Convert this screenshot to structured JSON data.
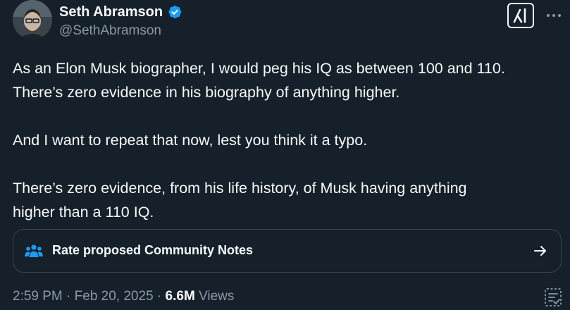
{
  "author": {
    "display_name": "Seth Abramson",
    "handle": "@SethAbramson",
    "verified": true,
    "avatar_icon": "avatar-photo"
  },
  "header_actions": {
    "grok_icon": "grok-icon",
    "more_icon": "more-dots-icon"
  },
  "tweet": {
    "paragraphs": [
      [
        "As an Elon Musk biographer, I would peg his IQ as between 100 and 110.",
        "There’s zero evidence in his biography of anything higher."
      ],
      [
        "And I want to repeat that now, lest you think it a typo."
      ],
      [
        "There’s zero evidence, from his life history, of Musk having anything",
        "higher than a 110 IQ."
      ]
    ]
  },
  "community_notes": {
    "label": "Rate proposed Community Notes",
    "icon": "people-icon",
    "arrow_icon": "arrow-right-icon"
  },
  "meta": {
    "time": "2:59 PM",
    "separator": "·",
    "date": "Feb 20, 2025",
    "views_count": "6.6M",
    "views_label": "Views",
    "analytics_icon": "analytics-icon"
  },
  "colors": {
    "background": "#15202b",
    "text": "#f7f9f9",
    "secondary_text": "#8b98a5",
    "accent": "#1d9bf0",
    "border": "#38444d"
  }
}
